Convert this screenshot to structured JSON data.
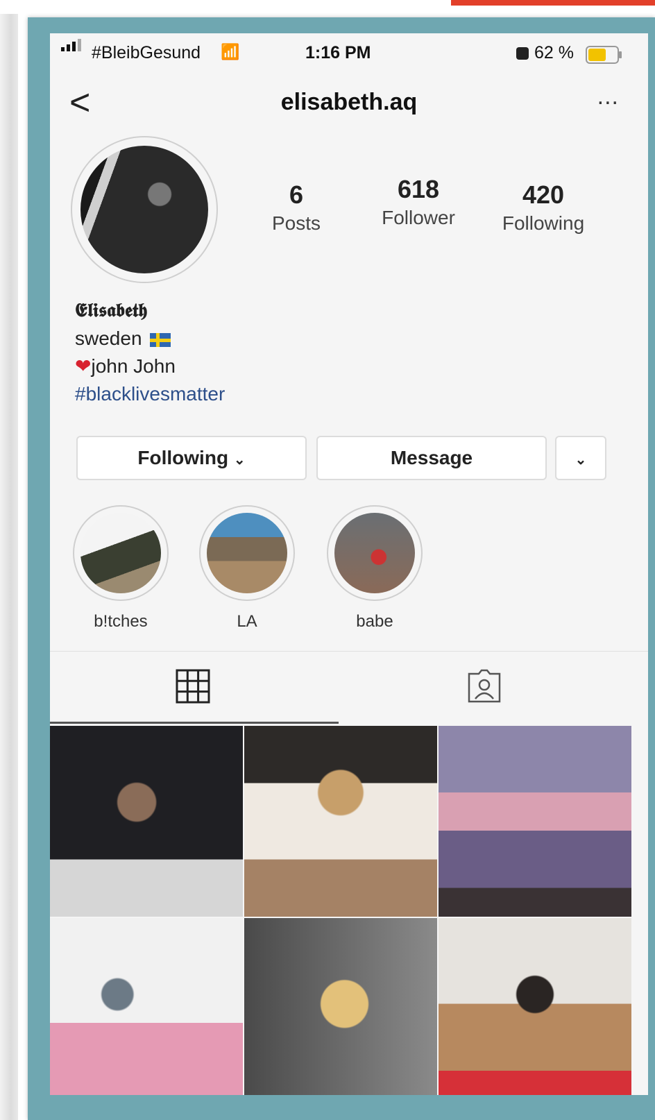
{
  "status_bar": {
    "carrier": "#BleibGesund",
    "time": "1:16 PM",
    "battery_percent": "62 %",
    "battery_level": 0.62,
    "battery_color": "#f2c200"
  },
  "nav": {
    "back_icon": "chevron-left-icon",
    "title": "elisabeth.aq",
    "more_icon": "more-horizontal-icon",
    "back_glyph": "<",
    "more_glyph": "..."
  },
  "profile": {
    "stats": [
      {
        "value": "6",
        "label": "Posts"
      },
      {
        "value": "618",
        "label": "Follower"
      },
      {
        "value": "420",
        "label": "Following"
      }
    ],
    "display_name": "𝕰𝖑𝖎𝖘𝖆𝖇𝖊𝖙𝖍",
    "bio_line1": "sweden",
    "bio_line2": "john John",
    "bio_hashtag": "#blacklivesmatter"
  },
  "actions": {
    "following_label": "Following",
    "message_label": "Message"
  },
  "highlights": [
    {
      "label": "b!tches"
    },
    {
      "label": "LA"
    },
    {
      "label": "babe"
    }
  ],
  "tabs": {
    "grid_icon": "grid-icon",
    "tagged_icon": "tagged-person-icon"
  },
  "colors": {
    "frame": "#6fa7b1",
    "accent_red": "#e2402a",
    "hashtag": "#2d4f8a"
  }
}
